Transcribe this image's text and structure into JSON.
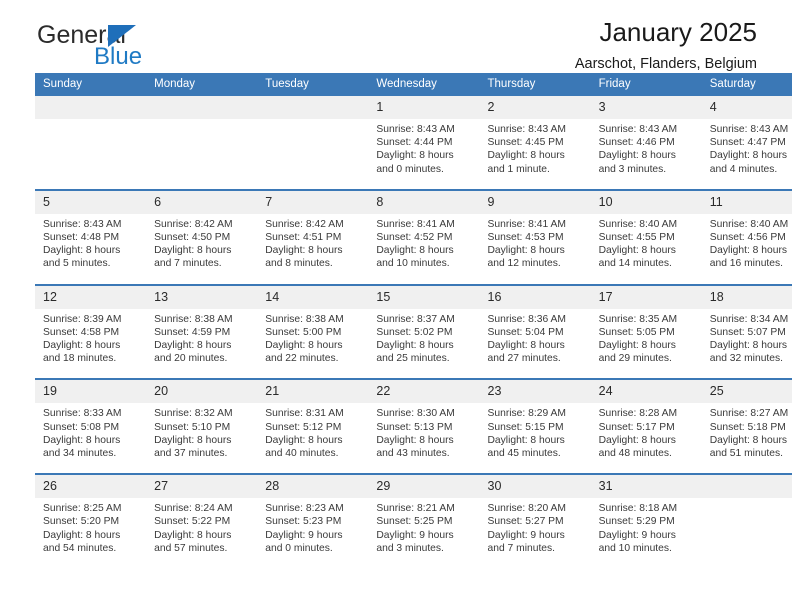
{
  "brand": {
    "name_part1": "General",
    "name_part2": "Blue",
    "accent_color": "#1f7ac4",
    "triangle_color": "#1f6fba"
  },
  "header": {
    "title": "January 2025",
    "subtitle": "Aarschot, Flanders, Belgium"
  },
  "theme": {
    "header_band": "#3b78b6",
    "daynum_band": "#f0f0f0",
    "text": "#3a3a3a"
  },
  "weekdays": [
    "Sunday",
    "Monday",
    "Tuesday",
    "Wednesday",
    "Thursday",
    "Friday",
    "Saturday"
  ],
  "weeks": [
    {
      "days": [
        {
          "num": "",
          "sunrise": "",
          "sunset": "",
          "daylight1": "",
          "daylight2": ""
        },
        {
          "num": "",
          "sunrise": "",
          "sunset": "",
          "daylight1": "",
          "daylight2": ""
        },
        {
          "num": "",
          "sunrise": "",
          "sunset": "",
          "daylight1": "",
          "daylight2": ""
        },
        {
          "num": "1",
          "sunrise": "Sunrise: 8:43 AM",
          "sunset": "Sunset: 4:44 PM",
          "daylight1": "Daylight: 8 hours",
          "daylight2": "and 0 minutes."
        },
        {
          "num": "2",
          "sunrise": "Sunrise: 8:43 AM",
          "sunset": "Sunset: 4:45 PM",
          "daylight1": "Daylight: 8 hours",
          "daylight2": "and 1 minute."
        },
        {
          "num": "3",
          "sunrise": "Sunrise: 8:43 AM",
          "sunset": "Sunset: 4:46 PM",
          "daylight1": "Daylight: 8 hours",
          "daylight2": "and 3 minutes."
        },
        {
          "num": "4",
          "sunrise": "Sunrise: 8:43 AM",
          "sunset": "Sunset: 4:47 PM",
          "daylight1": "Daylight: 8 hours",
          "daylight2": "and 4 minutes."
        }
      ]
    },
    {
      "days": [
        {
          "num": "5",
          "sunrise": "Sunrise: 8:43 AM",
          "sunset": "Sunset: 4:48 PM",
          "daylight1": "Daylight: 8 hours",
          "daylight2": "and 5 minutes."
        },
        {
          "num": "6",
          "sunrise": "Sunrise: 8:42 AM",
          "sunset": "Sunset: 4:50 PM",
          "daylight1": "Daylight: 8 hours",
          "daylight2": "and 7 minutes."
        },
        {
          "num": "7",
          "sunrise": "Sunrise: 8:42 AM",
          "sunset": "Sunset: 4:51 PM",
          "daylight1": "Daylight: 8 hours",
          "daylight2": "and 8 minutes."
        },
        {
          "num": "8",
          "sunrise": "Sunrise: 8:41 AM",
          "sunset": "Sunset: 4:52 PM",
          "daylight1": "Daylight: 8 hours",
          "daylight2": "and 10 minutes."
        },
        {
          "num": "9",
          "sunrise": "Sunrise: 8:41 AM",
          "sunset": "Sunset: 4:53 PM",
          "daylight1": "Daylight: 8 hours",
          "daylight2": "and 12 minutes."
        },
        {
          "num": "10",
          "sunrise": "Sunrise: 8:40 AM",
          "sunset": "Sunset: 4:55 PM",
          "daylight1": "Daylight: 8 hours",
          "daylight2": "and 14 minutes."
        },
        {
          "num": "11",
          "sunrise": "Sunrise: 8:40 AM",
          "sunset": "Sunset: 4:56 PM",
          "daylight1": "Daylight: 8 hours",
          "daylight2": "and 16 minutes."
        }
      ]
    },
    {
      "days": [
        {
          "num": "12",
          "sunrise": "Sunrise: 8:39 AM",
          "sunset": "Sunset: 4:58 PM",
          "daylight1": "Daylight: 8 hours",
          "daylight2": "and 18 minutes."
        },
        {
          "num": "13",
          "sunrise": "Sunrise: 8:38 AM",
          "sunset": "Sunset: 4:59 PM",
          "daylight1": "Daylight: 8 hours",
          "daylight2": "and 20 minutes."
        },
        {
          "num": "14",
          "sunrise": "Sunrise: 8:38 AM",
          "sunset": "Sunset: 5:00 PM",
          "daylight1": "Daylight: 8 hours",
          "daylight2": "and 22 minutes."
        },
        {
          "num": "15",
          "sunrise": "Sunrise: 8:37 AM",
          "sunset": "Sunset: 5:02 PM",
          "daylight1": "Daylight: 8 hours",
          "daylight2": "and 25 minutes."
        },
        {
          "num": "16",
          "sunrise": "Sunrise: 8:36 AM",
          "sunset": "Sunset: 5:04 PM",
          "daylight1": "Daylight: 8 hours",
          "daylight2": "and 27 minutes."
        },
        {
          "num": "17",
          "sunrise": "Sunrise: 8:35 AM",
          "sunset": "Sunset: 5:05 PM",
          "daylight1": "Daylight: 8 hours",
          "daylight2": "and 29 minutes."
        },
        {
          "num": "18",
          "sunrise": "Sunrise: 8:34 AM",
          "sunset": "Sunset: 5:07 PM",
          "daylight1": "Daylight: 8 hours",
          "daylight2": "and 32 minutes."
        }
      ]
    },
    {
      "days": [
        {
          "num": "19",
          "sunrise": "Sunrise: 8:33 AM",
          "sunset": "Sunset: 5:08 PM",
          "daylight1": "Daylight: 8 hours",
          "daylight2": "and 34 minutes."
        },
        {
          "num": "20",
          "sunrise": "Sunrise: 8:32 AM",
          "sunset": "Sunset: 5:10 PM",
          "daylight1": "Daylight: 8 hours",
          "daylight2": "and 37 minutes."
        },
        {
          "num": "21",
          "sunrise": "Sunrise: 8:31 AM",
          "sunset": "Sunset: 5:12 PM",
          "daylight1": "Daylight: 8 hours",
          "daylight2": "and 40 minutes."
        },
        {
          "num": "22",
          "sunrise": "Sunrise: 8:30 AM",
          "sunset": "Sunset: 5:13 PM",
          "daylight1": "Daylight: 8 hours",
          "daylight2": "and 43 minutes."
        },
        {
          "num": "23",
          "sunrise": "Sunrise: 8:29 AM",
          "sunset": "Sunset: 5:15 PM",
          "daylight1": "Daylight: 8 hours",
          "daylight2": "and 45 minutes."
        },
        {
          "num": "24",
          "sunrise": "Sunrise: 8:28 AM",
          "sunset": "Sunset: 5:17 PM",
          "daylight1": "Daylight: 8 hours",
          "daylight2": "and 48 minutes."
        },
        {
          "num": "25",
          "sunrise": "Sunrise: 8:27 AM",
          "sunset": "Sunset: 5:18 PM",
          "daylight1": "Daylight: 8 hours",
          "daylight2": "and 51 minutes."
        }
      ]
    },
    {
      "days": [
        {
          "num": "26",
          "sunrise": "Sunrise: 8:25 AM",
          "sunset": "Sunset: 5:20 PM",
          "daylight1": "Daylight: 8 hours",
          "daylight2": "and 54 minutes."
        },
        {
          "num": "27",
          "sunrise": "Sunrise: 8:24 AM",
          "sunset": "Sunset: 5:22 PM",
          "daylight1": "Daylight: 8 hours",
          "daylight2": "and 57 minutes."
        },
        {
          "num": "28",
          "sunrise": "Sunrise: 8:23 AM",
          "sunset": "Sunset: 5:23 PM",
          "daylight1": "Daylight: 9 hours",
          "daylight2": "and 0 minutes."
        },
        {
          "num": "29",
          "sunrise": "Sunrise: 8:21 AM",
          "sunset": "Sunset: 5:25 PM",
          "daylight1": "Daylight: 9 hours",
          "daylight2": "and 3 minutes."
        },
        {
          "num": "30",
          "sunrise": "Sunrise: 8:20 AM",
          "sunset": "Sunset: 5:27 PM",
          "daylight1": "Daylight: 9 hours",
          "daylight2": "and 7 minutes."
        },
        {
          "num": "31",
          "sunrise": "Sunrise: 8:18 AM",
          "sunset": "Sunset: 5:29 PM",
          "daylight1": "Daylight: 9 hours",
          "daylight2": "and 10 minutes."
        },
        {
          "num": "",
          "sunrise": "",
          "sunset": "",
          "daylight1": "",
          "daylight2": ""
        }
      ]
    }
  ]
}
